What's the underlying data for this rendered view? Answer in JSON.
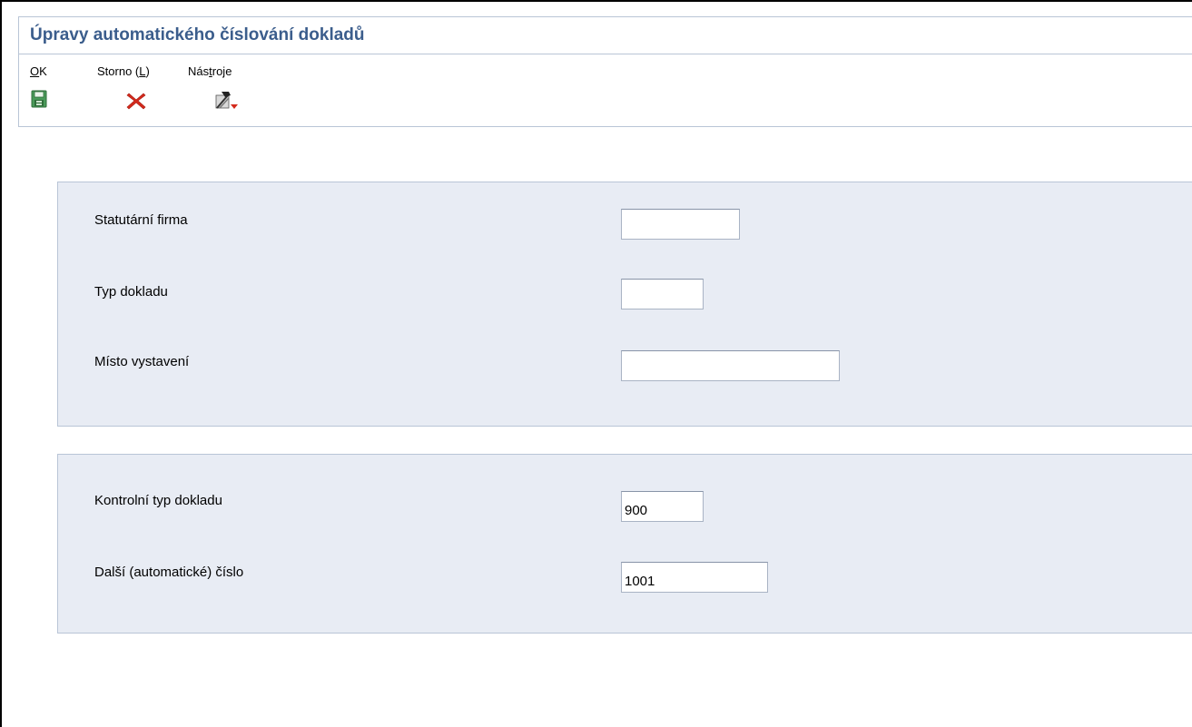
{
  "header": {
    "title": "Úpravy automatického číslování dokladů"
  },
  "toolbar": {
    "ok": {
      "prefix": "",
      "accel": "O",
      "suffix": "K",
      "icon": "save-disk-icon"
    },
    "cancel": {
      "prefix": "Storno (",
      "accel": "L",
      "suffix": ")",
      "icon": "red-x-icon"
    },
    "tools": {
      "prefix": "Nás",
      "accel": "t",
      "suffix": "roje",
      "icon": "tools-hammer-icon"
    }
  },
  "form": {
    "section1": {
      "company": {
        "label": "Statutární firma",
        "value": ""
      },
      "doc_type": {
        "label": "Typ dokladu",
        "value": ""
      },
      "place": {
        "label": "Místo vystavení",
        "value": ""
      }
    },
    "section2": {
      "control_doc_type": {
        "label": "Kontrolní typ dokladu",
        "value": "900"
      },
      "next_number": {
        "label": "Další (automatické) číslo",
        "value": "1001"
      }
    }
  },
  "colors": {
    "title": "#3b5d8c",
    "panel_bg": "#e8ecf4",
    "panel_border": "#b9c5d6",
    "cancel_red": "#d42a1c"
  }
}
